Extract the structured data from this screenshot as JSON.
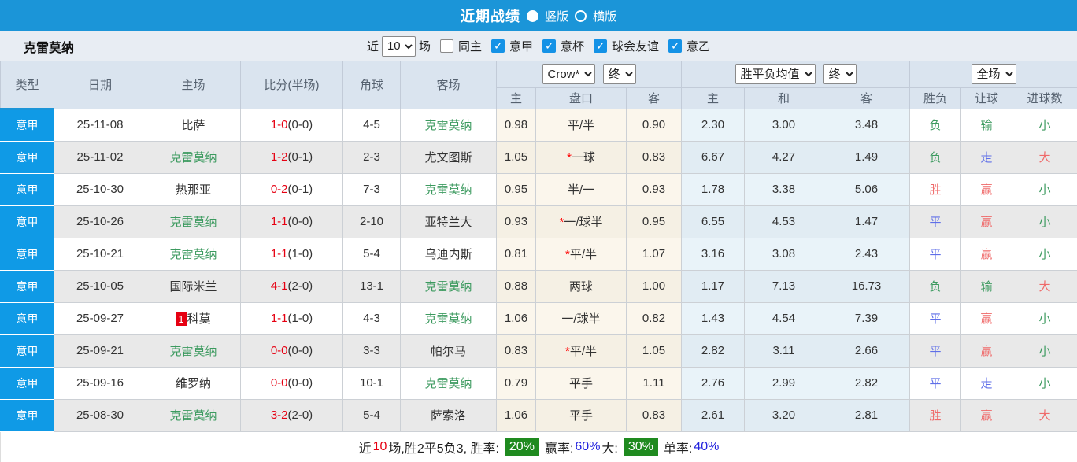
{
  "colors": {
    "topbar_blue": "#1b95d8",
    "league_badge_blue": "#0f9ae6",
    "target_team_green": "#3c9a5f",
    "win_red": "#ef6a6a",
    "draw_blue": "#5f6fe8",
    "score_red": "#e60012",
    "rate_badge_green": "#1f8a1f"
  },
  "topbar": {
    "title": "近期战绩",
    "radio_vertical_label": "竖版",
    "radio_horizontal_label": "横版"
  },
  "filter": {
    "team": "克雷莫纳",
    "near_label": "近",
    "count": "10",
    "games_label": "场",
    "checkboxes": [
      {
        "label": "同主",
        "state": "unchecked"
      },
      {
        "label": "意甲",
        "state": "checked"
      },
      {
        "label": "意杯",
        "state": "checked"
      },
      {
        "label": "球会友谊",
        "state": "checked"
      },
      {
        "label": "意乙",
        "state": "checked"
      }
    ]
  },
  "table": {
    "headers": {
      "type": "类型",
      "date": "日期",
      "home": "主场",
      "score": "比分(半场)",
      "corner": "角球",
      "away": "客场",
      "sub_home": "主",
      "sub_line": "盘口",
      "sub_away": "客",
      "sub_avg_home": "主",
      "sub_avg_draw": "和",
      "sub_avg_away": "客",
      "sub_result": "胜负",
      "sub_handicap": "让球",
      "sub_goals": "进球数"
    },
    "selects": {
      "company": "Crow*",
      "company_time": "终",
      "avg": "胜平负均值",
      "avg_time": "终",
      "scope": "全场"
    },
    "rows": [
      {
        "league": "意甲",
        "date": "25-11-08",
        "home": "比萨",
        "home_color": "dark",
        "home_badge": "",
        "score_main": "1-0",
        "score_half": "(0-0)",
        "corner": "4-5",
        "away": "克雷莫纳",
        "away_color": "green",
        "ah_home": "0.98",
        "ah_star": "",
        "ah_line": "平/半",
        "ah_away": "0.90",
        "avg_home": "2.30",
        "avg_draw": "3.00",
        "avg_away": "3.48",
        "result": "负",
        "result_color": "green",
        "handicap": "输",
        "handicap_color": "green",
        "goals": "小",
        "goals_color": "green"
      },
      {
        "league": "意甲",
        "date": "25-11-02",
        "home": "克雷莫纳",
        "home_color": "green",
        "home_badge": "",
        "score_main": "1-2",
        "score_half": "(0-1)",
        "corner": "2-3",
        "away": "尤文图斯",
        "away_color": "dark",
        "ah_home": "1.05",
        "ah_star": "*",
        "ah_line": "一球",
        "ah_away": "0.83",
        "avg_home": "6.67",
        "avg_draw": "4.27",
        "avg_away": "1.49",
        "result": "负",
        "result_color": "green",
        "handicap": "走",
        "handicap_color": "blue",
        "goals": "大",
        "goals_color": "red"
      },
      {
        "league": "意甲",
        "date": "25-10-30",
        "home": "热那亚",
        "home_color": "dark",
        "home_badge": "",
        "score_main": "0-2",
        "score_half": "(0-1)",
        "corner": "7-3",
        "away": "克雷莫纳",
        "away_color": "green",
        "ah_home": "0.95",
        "ah_star": "",
        "ah_line": "半/一",
        "ah_away": "0.93",
        "avg_home": "1.78",
        "avg_draw": "3.38",
        "avg_away": "5.06",
        "result": "胜",
        "result_color": "red",
        "handicap": "赢",
        "handicap_color": "red",
        "goals": "小",
        "goals_color": "green"
      },
      {
        "league": "意甲",
        "date": "25-10-26",
        "home": "克雷莫纳",
        "home_color": "green",
        "home_badge": "",
        "score_main": "1-1",
        "score_half": "(0-0)",
        "corner": "2-10",
        "away": "亚特兰大",
        "away_color": "dark",
        "ah_home": "0.93",
        "ah_star": "*",
        "ah_line": "一/球半",
        "ah_away": "0.95",
        "avg_home": "6.55",
        "avg_draw": "4.53",
        "avg_away": "1.47",
        "result": "平",
        "result_color": "blue",
        "handicap": "赢",
        "handicap_color": "red",
        "goals": "小",
        "goals_color": "green"
      },
      {
        "league": "意甲",
        "date": "25-10-21",
        "home": "克雷莫纳",
        "home_color": "green",
        "home_badge": "",
        "score_main": "1-1",
        "score_half": "(1-0)",
        "corner": "5-4",
        "away": "乌迪内斯",
        "away_color": "dark",
        "ah_home": "0.81",
        "ah_star": "*",
        "ah_line": "平/半",
        "ah_away": "1.07",
        "avg_home": "3.16",
        "avg_draw": "3.08",
        "avg_away": "2.43",
        "result": "平",
        "result_color": "blue",
        "handicap": "赢",
        "handicap_color": "red",
        "goals": "小",
        "goals_color": "green"
      },
      {
        "league": "意甲",
        "date": "25-10-05",
        "home": "国际米兰",
        "home_color": "dark",
        "home_badge": "",
        "score_main": "4-1",
        "score_half": "(2-0)",
        "corner": "13-1",
        "away": "克雷莫纳",
        "away_color": "green",
        "ah_home": "0.88",
        "ah_star": "",
        "ah_line": "两球",
        "ah_away": "1.00",
        "avg_home": "1.17",
        "avg_draw": "7.13",
        "avg_away": "16.73",
        "result": "负",
        "result_color": "green",
        "handicap": "输",
        "handicap_color": "green",
        "goals": "大",
        "goals_color": "red"
      },
      {
        "league": "意甲",
        "date": "25-09-27",
        "home": "科莫",
        "home_color": "dark",
        "home_badge": "1",
        "score_main": "1-1",
        "score_half": "(1-0)",
        "corner": "4-3",
        "away": "克雷莫纳",
        "away_color": "green",
        "ah_home": "1.06",
        "ah_star": "",
        "ah_line": "一/球半",
        "ah_away": "0.82",
        "avg_home": "1.43",
        "avg_draw": "4.54",
        "avg_away": "7.39",
        "result": "平",
        "result_color": "blue",
        "handicap": "赢",
        "handicap_color": "red",
        "goals": "小",
        "goals_color": "green"
      },
      {
        "league": "意甲",
        "date": "25-09-21",
        "home": "克雷莫纳",
        "home_color": "green",
        "home_badge": "",
        "score_main": "0-0",
        "score_half": "(0-0)",
        "corner": "3-3",
        "away": "帕尔马",
        "away_color": "dark",
        "ah_home": "0.83",
        "ah_star": "*",
        "ah_line": "平/半",
        "ah_away": "1.05",
        "avg_home": "2.82",
        "avg_draw": "3.11",
        "avg_away": "2.66",
        "result": "平",
        "result_color": "blue",
        "handicap": "赢",
        "handicap_color": "red",
        "goals": "小",
        "goals_color": "green"
      },
      {
        "league": "意甲",
        "date": "25-09-16",
        "home": "维罗纳",
        "home_color": "dark",
        "home_badge": "",
        "score_main": "0-0",
        "score_half": "(0-0)",
        "corner": "10-1",
        "away": "克雷莫纳",
        "away_color": "green",
        "ah_home": "0.79",
        "ah_star": "",
        "ah_line": "平手",
        "ah_away": "1.11",
        "avg_home": "2.76",
        "avg_draw": "2.99",
        "avg_away": "2.82",
        "result": "平",
        "result_color": "blue",
        "handicap": "走",
        "handicap_color": "blue",
        "goals": "小",
        "goals_color": "green"
      },
      {
        "league": "意甲",
        "date": "25-08-30",
        "home": "克雷莫纳",
        "home_color": "green",
        "home_badge": "",
        "score_main": "3-2",
        "score_half": "(2-0)",
        "corner": "5-4",
        "away": "萨索洛",
        "away_color": "dark",
        "ah_home": "1.06",
        "ah_star": "",
        "ah_line": "平手",
        "ah_away": "0.83",
        "avg_home": "2.61",
        "avg_draw": "3.20",
        "avg_away": "2.81",
        "result": "胜",
        "result_color": "red",
        "handicap": "赢",
        "handicap_color": "red",
        "goals": "大",
        "goals_color": "red"
      }
    ]
  },
  "footer": {
    "near_label": "近",
    "count": "10",
    "record": "场,胜2平5负3, 胜率:",
    "win_rate": "20%",
    "win_odds_label": "赢率:",
    "win_odds_value": "60%",
    "big_label": "大:",
    "big_rate": "30%",
    "single_label": "单率:",
    "single_value": "40%"
  }
}
